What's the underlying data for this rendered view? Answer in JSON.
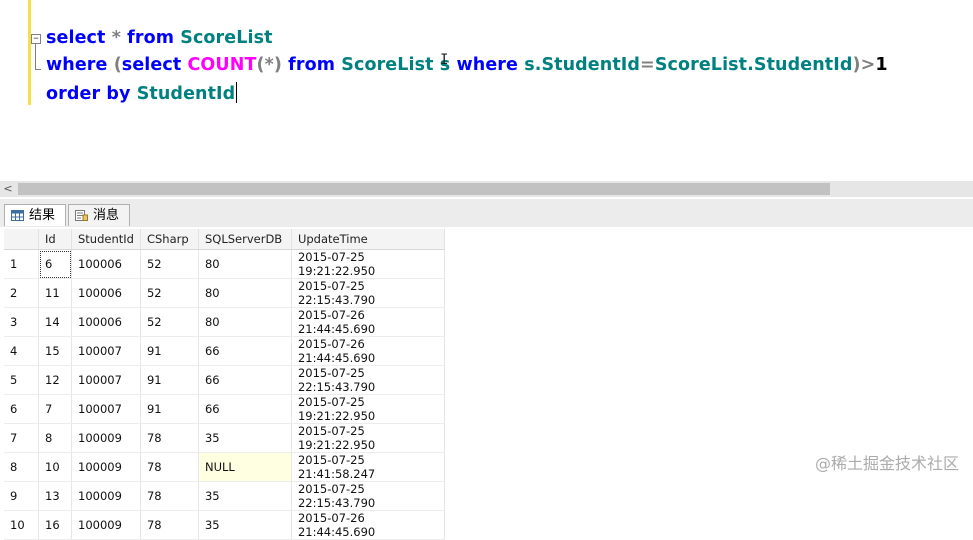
{
  "editor": {
    "outline_toggle": "−",
    "line1": {
      "kw1": "select",
      "op1": " * ",
      "kw2": "from",
      "id1": " ScoreList"
    },
    "line2": {
      "kw1": "where",
      "op1": " (",
      "kw2": "select",
      "fn1": " COUNT",
      "op2": "(*)",
      "kw3": " from",
      "id1": " ScoreList s",
      "kw4": " where",
      "id2": " s.StudentId",
      "op3": "=",
      "id3": "ScoreList.StudentId",
      "op4": ")>",
      "tx1": "1"
    },
    "line3": {
      "kw1": "order by",
      "id1": " StudentId"
    }
  },
  "scrollbar": {
    "left_arrow": "<"
  },
  "tabs": [
    {
      "label": "结果",
      "icon": "grid-results-icon"
    },
    {
      "label": "消息",
      "icon": "messages-icon"
    }
  ],
  "grid": {
    "columns": [
      "",
      "Id",
      "StudentId",
      "CSharp",
      "SQLServerDB",
      "UpdateTime"
    ],
    "rows": [
      [
        "1",
        "6",
        "100006",
        "52",
        "80",
        "2015-07-25 19:21:22.950"
      ],
      [
        "2",
        "11",
        "100006",
        "52",
        "80",
        "2015-07-25 22:15:43.790"
      ],
      [
        "3",
        "14",
        "100006",
        "52",
        "80",
        "2015-07-26 21:44:45.690"
      ],
      [
        "4",
        "15",
        "100007",
        "91",
        "66",
        "2015-07-26 21:44:45.690"
      ],
      [
        "5",
        "12",
        "100007",
        "91",
        "66",
        "2015-07-25 22:15:43.790"
      ],
      [
        "6",
        "7",
        "100007",
        "91",
        "66",
        "2015-07-25 19:21:22.950"
      ],
      [
        "7",
        "8",
        "100009",
        "78",
        "35",
        "2015-07-25 19:21:22.950"
      ],
      [
        "8",
        "10",
        "100009",
        "78",
        "NULL",
        "2015-07-25 21:41:58.247"
      ],
      [
        "9",
        "13",
        "100009",
        "78",
        "35",
        "2015-07-25 22:15:43.790"
      ],
      [
        "10",
        "16",
        "100009",
        "78",
        "35",
        "2015-07-26 21:44:45.690"
      ]
    ]
  },
  "watermark": "@稀土掘金技术社区",
  "colors": {
    "keyword": "#0000ff",
    "identifier": "#008080",
    "function": "#ff00ff",
    "operator": "#808080",
    "null_cell": "#ffffe1"
  }
}
